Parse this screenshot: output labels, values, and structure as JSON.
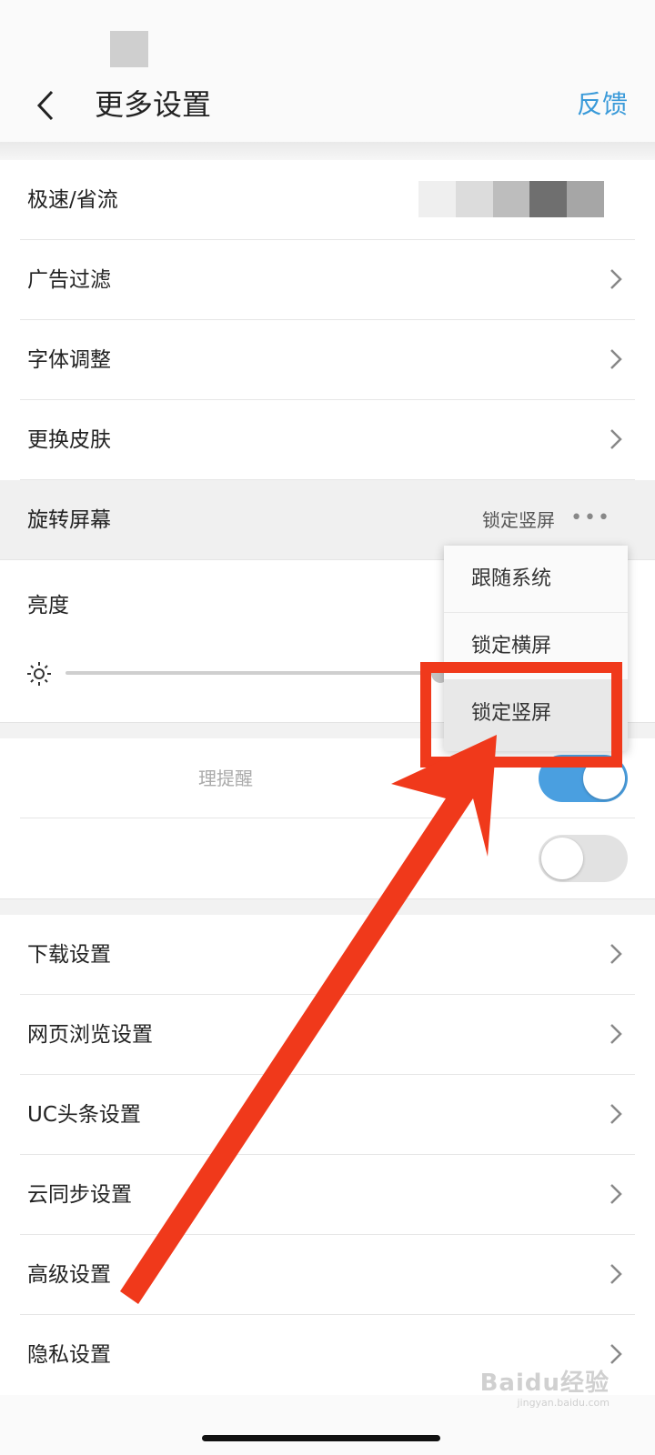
{
  "header": {
    "title": "更多设置",
    "feedback": "反馈"
  },
  "section1": {
    "speed": "极速/省流",
    "items": [
      "广告过滤",
      "字体调整",
      "更换皮肤"
    ]
  },
  "rotate": {
    "label": "旋转屏幕",
    "value": "锁定竖屏",
    "more": "•••"
  },
  "brightness": {
    "label": "亮度",
    "level_percent": 60
  },
  "toggles": {
    "reminder": {
      "label": "理提醒",
      "on": true
    },
    "second": {
      "label": "",
      "on": false
    }
  },
  "menu": {
    "items": [
      "跟随系统",
      "锁定横屏",
      "锁定竖屏"
    ],
    "selected": "锁定竖屏"
  },
  "section2": {
    "items": [
      "下载设置",
      "网页浏览设置",
      "UC头条设置",
      "云同步设置",
      "高级设置",
      "隐私设置"
    ]
  },
  "watermark": {
    "brand": "Baidu经验",
    "site": "jingyan.baidu.com"
  },
  "colors": {
    "accent": "#3a9ad9",
    "annotation": "#f0391b",
    "toggle_on": "#4a9fe0"
  }
}
